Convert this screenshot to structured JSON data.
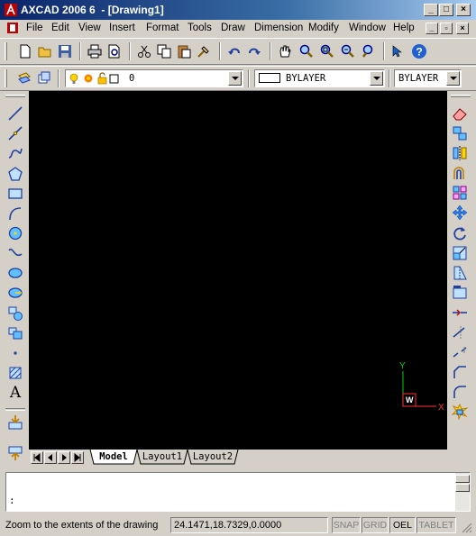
{
  "window": {
    "title": "AXCAD 2006 6  - [Drawing1]",
    "minimize": "_",
    "maximize": "□",
    "close": "×"
  },
  "menu": {
    "items": [
      "File",
      "Edit",
      "View",
      "Insert",
      "Format",
      "Tools",
      "Draw",
      "Dimension",
      "Modify",
      "Window",
      "Help"
    ]
  },
  "standard_toolbar": {
    "icons": [
      "new-icon",
      "open-icon",
      "save-icon",
      "print-icon",
      "print-preview-icon",
      "cut-icon",
      "copy-icon",
      "paste-icon",
      "match-properties-icon",
      "undo-icon",
      "redo-icon",
      "pan-icon",
      "zoom-realtime-icon",
      "zoom-window-icon",
      "zoom-previous-icon",
      "zoom-extents-icon",
      "properties-icon",
      "help-icon"
    ]
  },
  "layers_toolbar": {
    "current_layer": "0",
    "color": "BYLAYER",
    "linetype": "BYLAYER"
  },
  "draw_toolbar": {
    "icons": [
      "line-icon",
      "construction-line-icon",
      "polyline-icon",
      "polygon-icon",
      "rectangle-icon",
      "arc-icon",
      "circle-icon",
      "spline-icon",
      "ellipse-icon",
      "ellipse-arc-icon",
      "insert-block-icon",
      "make-block-icon",
      "point-icon",
      "hatch-icon",
      "text-icon",
      "import-icon",
      "export-icon"
    ],
    "text_glyph": "A"
  },
  "modify_toolbar": {
    "icons": [
      "erase-icon",
      "copy-object-icon",
      "mirror-icon",
      "offset-icon",
      "array-icon",
      "move-icon",
      "rotate-icon",
      "scale-icon",
      "stretch-icon",
      "lengthen-icon",
      "trim-icon",
      "extend-icon",
      "break-icon",
      "chamfer-icon",
      "fillet-icon",
      "explode-icon"
    ]
  },
  "ucs": {
    "x_label": "X",
    "y_label": "Y",
    "w_label": "W",
    "x_color": "#ff3030",
    "y_color": "#00d000",
    "w_color": "#ff3030"
  },
  "tabs": {
    "items": [
      "Model",
      "Layout1",
      "Layout2"
    ],
    "active": "Model"
  },
  "command": {
    "line1": "",
    "line2": ":"
  },
  "status": {
    "message": "Zoom to the extents of the drawing",
    "coordinates": "24.1471,18.7329,0.0000",
    "toggles": [
      {
        "label": "SNAP",
        "on": false
      },
      {
        "label": "GRID",
        "on": false
      },
      {
        "label": "OEL",
        "on": true
      },
      {
        "label": "TABLET",
        "on": false
      }
    ]
  }
}
